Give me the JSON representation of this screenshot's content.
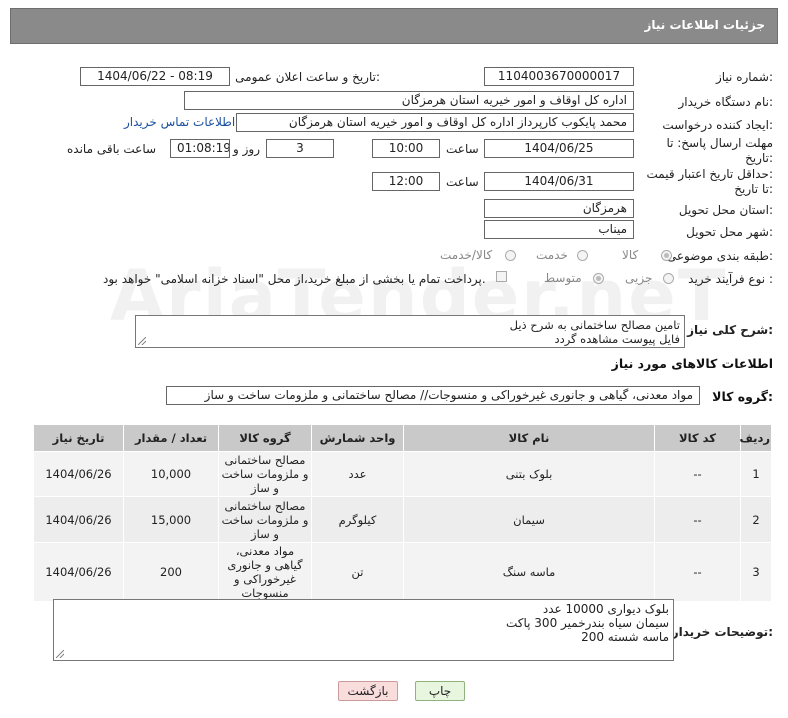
{
  "header": {
    "title": "جزئیات اطلاعات نیاز"
  },
  "fields": {
    "need_number": {
      "label": "شماره نیاز:",
      "value": "1104003670000017"
    },
    "announce_datetime": {
      "label": "تاریخ و ساعت اعلان عمومی:",
      "value": "1404/06/22 - 08:19"
    },
    "buyer_org": {
      "label": "نام دستگاه خریدار:",
      "value": "اداره کل اوقاف و امور خیریه استان هرمزگان"
    },
    "requester": {
      "label": "ایجاد کننده درخواست:",
      "value": "محمد پایکوب کارپرداز اداره کل اوقاف و امور خیریه استان هرمزگان",
      "contact_link": "اطلاعات تماس خریدار"
    },
    "deadline": {
      "label_line1": "مهلت ارسال پاسخ: تا",
      "label_line2": "تاریخ:",
      "date": "1404/06/25",
      "time_label": "ساعت",
      "time": "10:00",
      "days": "3",
      "days_label": "روز و",
      "remaining": "01:08:19",
      "remaining_label": "ساعت باقی مانده"
    },
    "price_validity": {
      "label_line1": "حداقل تاریخ اعتبار قیمت:",
      "label_line2": "تا تاریخ:",
      "date": "1404/06/31",
      "time_label": "ساعت",
      "time": "12:00"
    },
    "delivery_province": {
      "label": "استان محل تحویل:",
      "value": "هرمزگان"
    },
    "delivery_city": {
      "label": "شهر محل تحویل:",
      "value": "میناب"
    },
    "category": {
      "label": "طبقه بندی موضوعی:",
      "options": [
        "کالا",
        "خدمت",
        "کالا/خدمت"
      ],
      "selected": "کالا"
    },
    "purchase_process": {
      "label": "نوع فرآیند خرید :",
      "options": [
        "جزیی",
        "متوسط"
      ],
      "selected": "متوسط",
      "payment_note": "پرداخت تمام یا بخشی از مبلغ خرید،از محل \"اسناد خزانه اسلامی\" خواهد بود."
    },
    "description": {
      "label": "شرح کلی نیاز:",
      "line1": "تامین مصالح ساختمانی به شرح ذیل",
      "line2": "فایل پیوست مشاهده گردد"
    }
  },
  "goods_section": {
    "title": "اطلاعات کالاهای مورد نیاز",
    "group_label": "گروه کالا:",
    "group_value": "مواد معدنی، گیاهی و جانوری غیرخوراکی و منسوجات// مصالح ساختمانی و ملزومات ساخت و ساز"
  },
  "table": {
    "columns": [
      "ردیف",
      "کد کالا",
      "نام کالا",
      "واحد شمارش",
      "گروه کالا",
      "تعداد / مقدار",
      "تاریخ نیاز"
    ],
    "rows": [
      {
        "index": "1",
        "code": "--",
        "name": "بلوک بتنی",
        "unit": "عدد",
        "group": "مصالح ساختمانی و ملزومات ساخت و ساز",
        "qty": "10,000",
        "date": "1404/06/26"
      },
      {
        "index": "2",
        "code": "--",
        "name": "سیمان",
        "unit": "کیلوگرم",
        "group": "مصالح ساختمانی و ملزومات ساخت و ساز",
        "qty": "15,000",
        "date": "1404/06/26"
      },
      {
        "index": "3",
        "code": "--",
        "name": "ماسه سنگ",
        "unit": "تن",
        "group": "مواد معدنی، گیاهی و جانوری غیرخوراکی و منسوجات",
        "qty": "200",
        "date": "1404/06/26"
      }
    ]
  },
  "buyer_notes": {
    "label": "توضیحات خریدار:",
    "lines": [
      "بلوک دیواری 10000 عدد",
      "سیمان سیاه بندرخمیر 300 پاکت",
      "ماسه شسته 200"
    ]
  },
  "buttons": {
    "print": "چاپ",
    "back": "بازگشت"
  },
  "watermark": "AriaTender.neT"
}
